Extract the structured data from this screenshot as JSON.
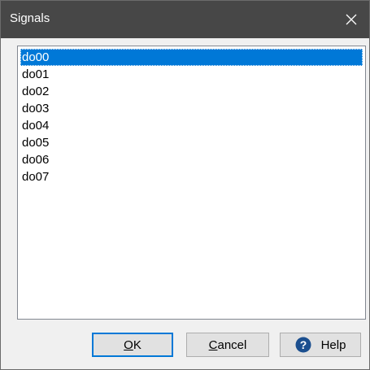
{
  "window": {
    "title": "Signals"
  },
  "list": {
    "selected_index": 0,
    "items": [
      "do00",
      "do01",
      "do02",
      "do03",
      "do04",
      "do05",
      "do06",
      "do07"
    ]
  },
  "buttons": {
    "ok": {
      "mnemonic": "O",
      "rest": "K"
    },
    "cancel": {
      "mnemonic": "C",
      "rest": "ancel"
    },
    "help": {
      "label": "Help"
    }
  },
  "icons": {
    "close": "close-icon",
    "help": "question-circle-icon"
  },
  "colors": {
    "titlebar": "#474747",
    "selection": "#0078d7",
    "window_bg": "#f0f0f0",
    "help_icon": "#1b4f8f"
  }
}
